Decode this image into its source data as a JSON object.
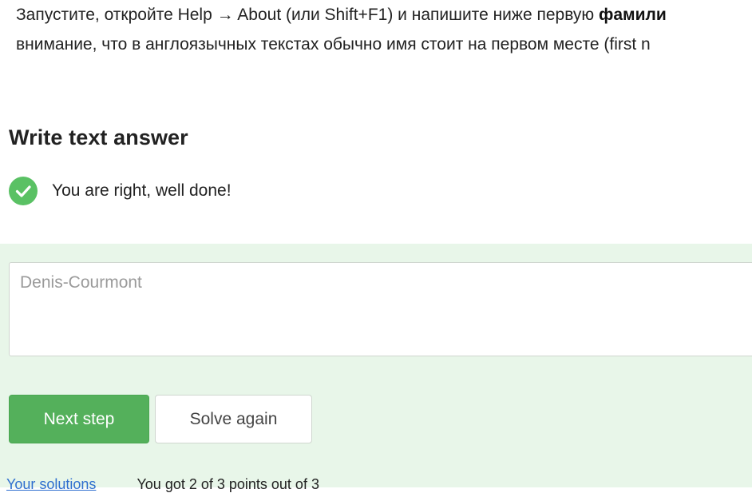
{
  "instructions": {
    "line1_prefix": "Запустите, откройте Help → About (или Shift+F1) и напишите ниже первую ",
    "line1_bold": "фамили",
    "line2": "внимание, что в англоязычных текстах обычно имя стоит на первом месте (first n"
  },
  "answer_section": {
    "heading": "Write text answer",
    "status_text": "You are right, well done!",
    "status_icon": "checkmark-circle-icon",
    "status_color": "#5ac164"
  },
  "answer_field": {
    "value": "Denis-Courmont"
  },
  "buttons": {
    "next_step": "Next step",
    "solve_again": "Solve again"
  },
  "footer": {
    "link_text": "Your solutions",
    "count_text": "You got 2 of 3 points out of 3"
  },
  "colors": {
    "panel_bg": "#e8f6e9",
    "primary_button": "#54b05b"
  }
}
